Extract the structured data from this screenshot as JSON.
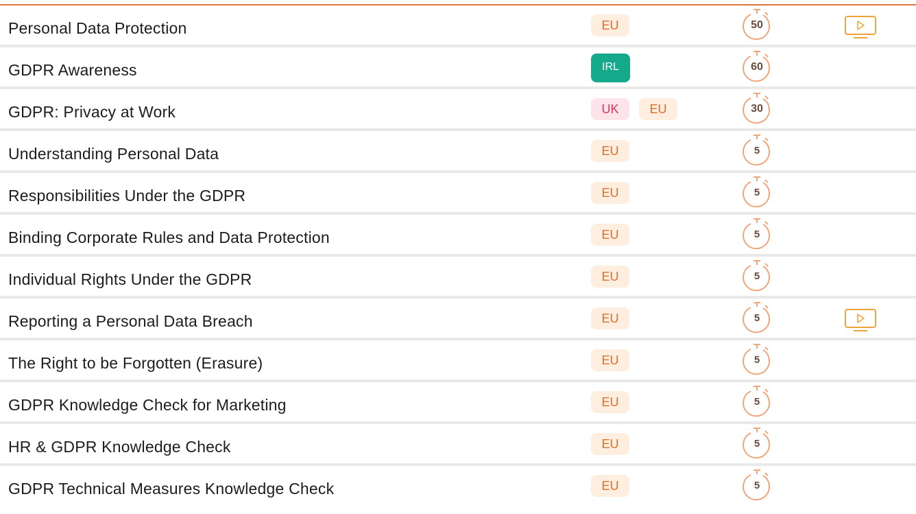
{
  "courses": [
    {
      "title": "Personal Data Protection",
      "badges": [
        {
          "code": "EU",
          "kind": "eu"
        }
      ],
      "minutes": "50",
      "has_video": true
    },
    {
      "title": "GDPR Awareness",
      "badges": [
        {
          "code": "IRL",
          "kind": "irl"
        }
      ],
      "minutes": "60",
      "has_video": false
    },
    {
      "title": "GDPR: Privacy at Work",
      "badges": [
        {
          "code": "UK",
          "kind": "uk"
        },
        {
          "code": "EU",
          "kind": "eu"
        }
      ],
      "minutes": "30",
      "has_video": false
    },
    {
      "title": "Understanding Personal Data",
      "badges": [
        {
          "code": "EU",
          "kind": "eu"
        }
      ],
      "minutes": "5",
      "has_video": false
    },
    {
      "title": "Responsibilities Under the GDPR",
      "badges": [
        {
          "code": "EU",
          "kind": "eu"
        }
      ],
      "minutes": "5",
      "has_video": false
    },
    {
      "title": "Binding Corporate Rules and Data Protection",
      "badges": [
        {
          "code": "EU",
          "kind": "eu"
        }
      ],
      "minutes": "5",
      "has_video": false
    },
    {
      "title": "Individual Rights Under the GDPR",
      "badges": [
        {
          "code": "EU",
          "kind": "eu"
        }
      ],
      "minutes": "5",
      "has_video": false
    },
    {
      "title": "Reporting a Personal Data Breach",
      "badges": [
        {
          "code": "EU",
          "kind": "eu"
        }
      ],
      "minutes": "5",
      "has_video": true
    },
    {
      "title": "The Right to be Forgotten (Erasure)",
      "badges": [
        {
          "code": "EU",
          "kind": "eu"
        }
      ],
      "minutes": "5",
      "has_video": false
    },
    {
      "title": "GDPR Knowledge Check for Marketing",
      "badges": [
        {
          "code": "EU",
          "kind": "eu"
        }
      ],
      "minutes": "5",
      "has_video": false
    },
    {
      "title": "HR & GDPR Knowledge Check",
      "badges": [
        {
          "code": "EU",
          "kind": "eu"
        }
      ],
      "minutes": "5",
      "has_video": false
    },
    {
      "title": "GDPR Technical Measures Knowledge Check",
      "badges": [
        {
          "code": "EU",
          "kind": "eu"
        }
      ],
      "minutes": "5",
      "has_video": false
    }
  ],
  "colors": {
    "accent_rule": "#d9743a",
    "eu_badge_bg": "#fdeee0",
    "eu_badge_text": "#e06e2e",
    "uk_badge_bg": "#fde3ea",
    "uk_badge_text": "#d9365f",
    "irl_badge_bg": "#14a98a",
    "timer_stroke": "#f0a57a",
    "video_stroke": "#f0a33a"
  },
  "icons": {
    "timer": "stopwatch-icon",
    "video": "video-play-icon"
  }
}
